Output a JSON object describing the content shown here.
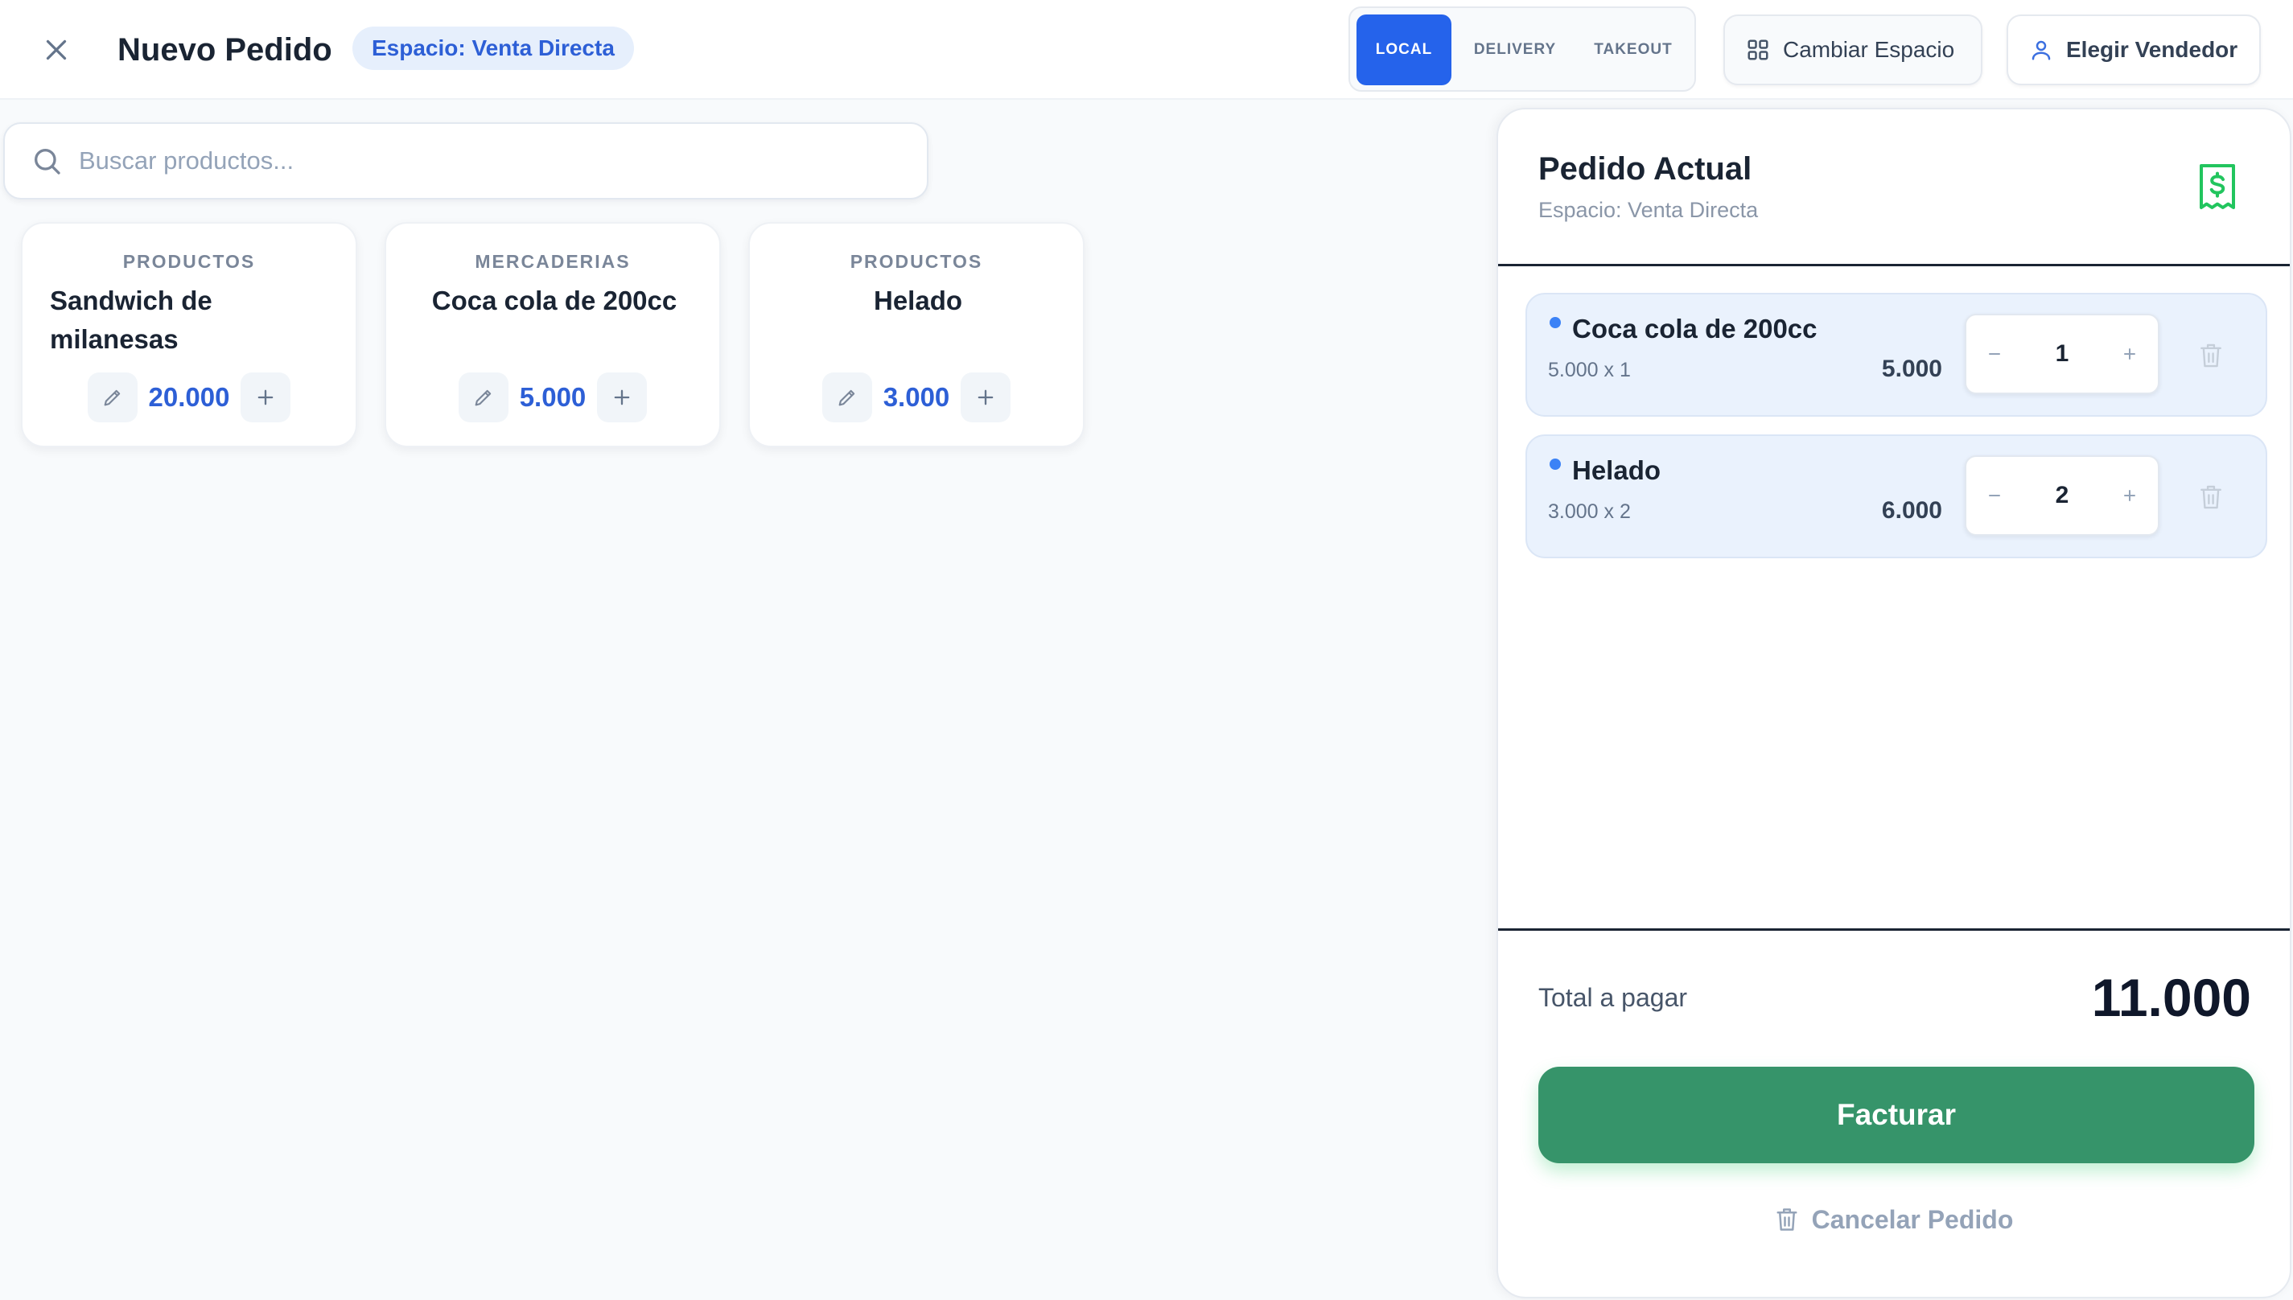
{
  "header": {
    "title": "Nuevo Pedido",
    "space_badge": "Espacio: Venta Directa",
    "modes": [
      {
        "label": "LOCAL",
        "active": true
      },
      {
        "label": "DELIVERY",
        "active": false
      },
      {
        "label": "TAKEOUT",
        "active": false
      }
    ],
    "change_space_label": "Cambiar Espacio",
    "choose_seller_label": "Elegir Vendedor",
    "icons": {
      "close": "close-icon",
      "change_space": "grid-icon",
      "seller": "user-icon"
    }
  },
  "search": {
    "placeholder": "Buscar productos...",
    "value": "",
    "icon": "search-icon"
  },
  "products": [
    {
      "category": "PRODUCTOS",
      "name": "Sandwich de milanesas",
      "price": "20.000"
    },
    {
      "category": "MERCADERIAS",
      "name": "Coca cola de 200cc",
      "price": "5.000"
    },
    {
      "category": "PRODUCTOS",
      "name": "Helado",
      "price": "3.000"
    }
  ],
  "order": {
    "title": "Pedido Actual",
    "subtitle": "Espacio: Venta Directa",
    "receipt_icon": "receipt-dollar-icon",
    "items": [
      {
        "name": "Coca cola de 200cc",
        "detail": "5.000 x 1",
        "subtotal": "5.000",
        "qty": "1"
      },
      {
        "name": "Helado",
        "detail": "3.000 x 2",
        "subtotal": "6.000",
        "qty": "2"
      }
    ],
    "total_label": "Total a pagar",
    "total_value": "11.000",
    "invoice_label": "Facturar",
    "cancel_label": "Cancelar Pedido"
  },
  "colors": {
    "accent": "#2563eb",
    "price_blue": "#2d5fd6",
    "invoice_green": "#36946a",
    "receipt_green": "#22c55e",
    "badge_bg": "#e6effc",
    "item_bg": "#eaf2fd"
  }
}
